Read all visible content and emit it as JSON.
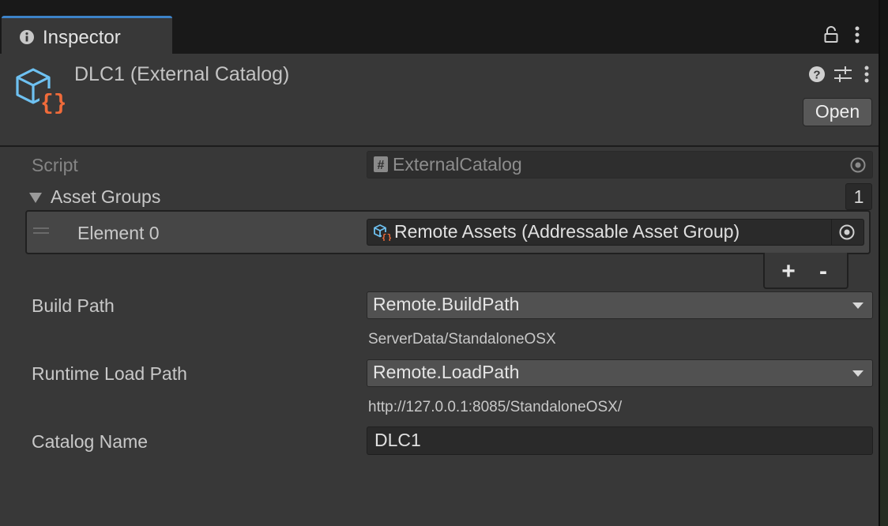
{
  "tab": {
    "title": "Inspector",
    "icon": "info-icon"
  },
  "header": {
    "title": "DLC1 (External Catalog)",
    "asset_icon": "external-catalog-icon",
    "open_label": "Open"
  },
  "fields": {
    "script": {
      "label": "Script",
      "value": "ExternalCatalog"
    },
    "asset_groups": {
      "label": "Asset Groups",
      "count": "1",
      "elements": [
        {
          "label": "Element 0",
          "value": "Remote Assets (Addressable Asset Group)"
        }
      ],
      "add_label": "+",
      "remove_label": "-"
    },
    "build_path": {
      "label": "Build Path",
      "value": "Remote.BuildPath",
      "resolved": "ServerData/StandaloneOSX"
    },
    "runtime_load_path": {
      "label": "Runtime Load Path",
      "value": "Remote.LoadPath",
      "resolved": "http://127.0.0.1:8085/StandaloneOSX/"
    },
    "catalog_name": {
      "label": "Catalog Name",
      "value": "DLC1"
    }
  },
  "colors": {
    "panel_bg": "#383838",
    "tab_accent": "#3d83c9",
    "icon_blue": "#6ec1f1",
    "icon_orange": "#f06b3a"
  }
}
